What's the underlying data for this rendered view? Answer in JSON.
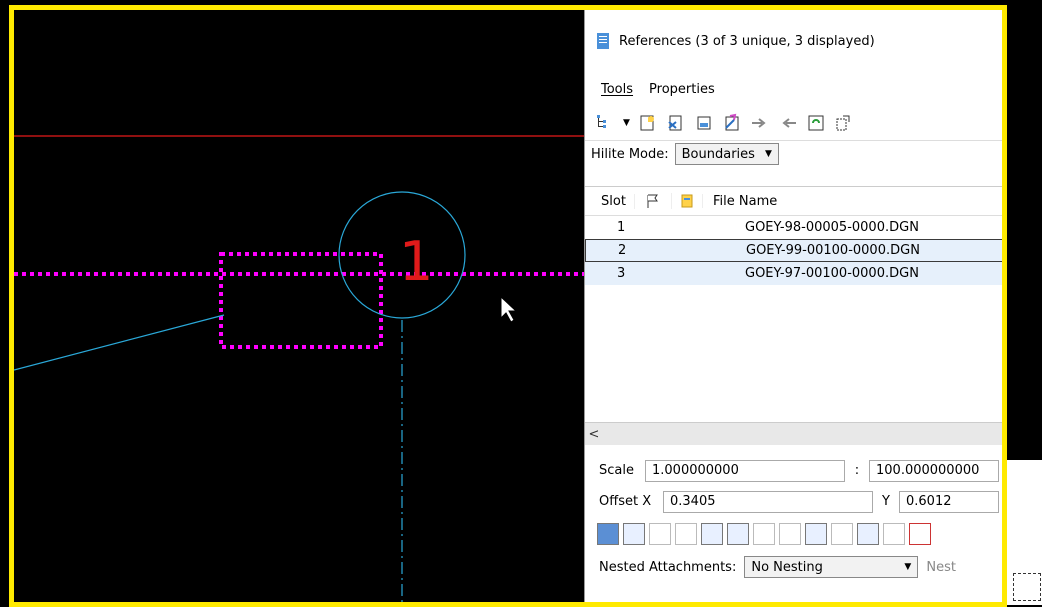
{
  "panel": {
    "title": "References (3 of 3 unique, 3 displayed)",
    "menus": [
      "Tools",
      "Properties"
    ],
    "hilite_label": "Hilite Mode:",
    "hilite_value": "Boundaries",
    "columns": {
      "slot": "Slot",
      "file_name": "File Name"
    },
    "rows": [
      {
        "slot": "1",
        "file": "GOEY-98-00005-0000.DGN"
      },
      {
        "slot": "2",
        "file": "GOEY-99-00100-0000.DGN"
      },
      {
        "slot": "3",
        "file": "GOEY-97-00100-0000.DGN"
      }
    ],
    "scroll_left": "<",
    "scale_label": "Scale",
    "scale_value": "1.000000000",
    "ratio_sep": ":",
    "scale_value2": "100.000000000",
    "offset_x_label": "Offset X",
    "offset_x_value": "0.3405",
    "offset_y_label": "Y",
    "offset_y_value": "0.6012",
    "nested_label": "Nested Attachments:",
    "nested_value": "No Nesting",
    "nested_extra": "Nest"
  },
  "canvas": {
    "label": "1"
  },
  "colors": {
    "frame": "#ffea00",
    "magenta": "#ff00ff",
    "cyan": "#2aa8d8",
    "red": "#e01a1a"
  }
}
